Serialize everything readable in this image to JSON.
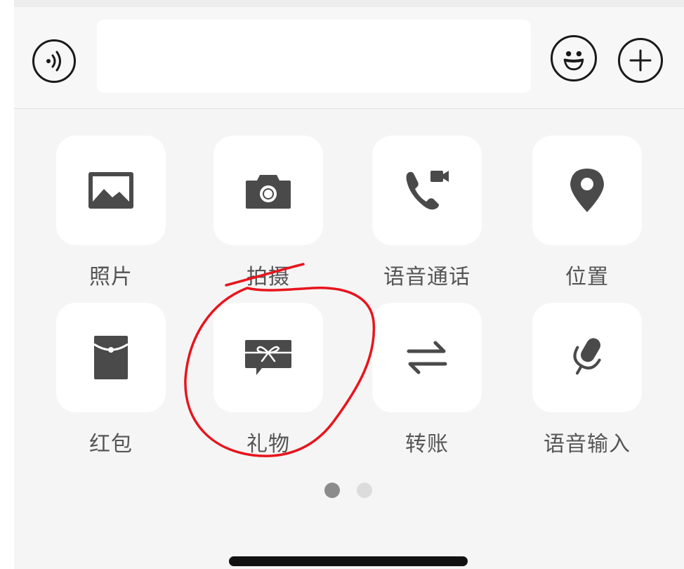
{
  "input_bar": {
    "voice_icon": "voice-wave-icon",
    "emoji_icon": "smiley-face-icon",
    "plus_icon": "plus-icon",
    "text_value": ""
  },
  "panel": {
    "items": [
      {
        "label": "照片",
        "icon": "photo-icon"
      },
      {
        "label": "拍摄",
        "icon": "camera-icon"
      },
      {
        "label": "语音通话",
        "icon": "phone-video-call-icon"
      },
      {
        "label": "位置",
        "icon": "location-pin-icon"
      },
      {
        "label": "红包",
        "icon": "red-envelope-icon"
      },
      {
        "label": "礼物",
        "icon": "gift-icon"
      },
      {
        "label": "转账",
        "icon": "transfer-arrows-icon"
      },
      {
        "label": "语音输入",
        "icon": "microphone-icon"
      }
    ]
  },
  "pagination": {
    "current_page": 1,
    "total_pages": 2
  },
  "colors": {
    "icon": "#4a4a4a",
    "label": "#555555",
    "panel_bg": "#f5f5f5",
    "tile_bg": "#ffffff",
    "annotation": "#e8141c"
  }
}
